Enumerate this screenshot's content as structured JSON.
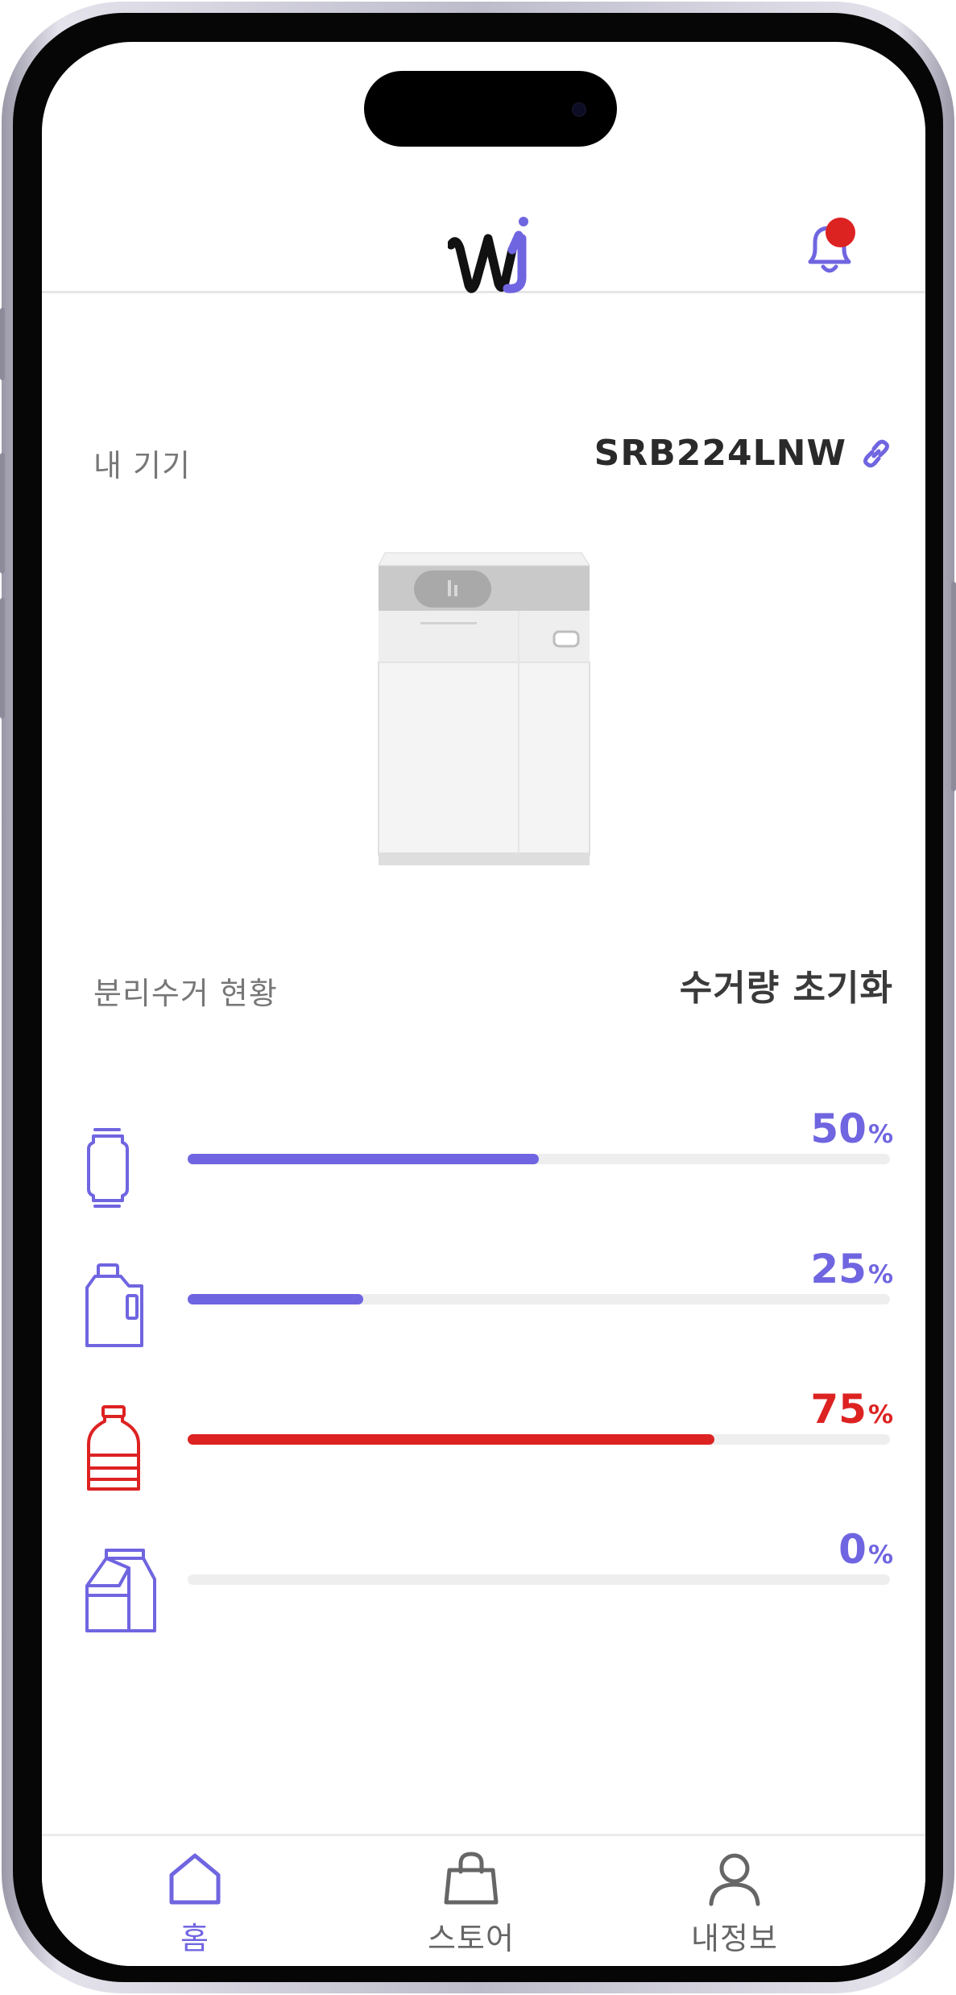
{
  "header": {
    "logo_icon": "brand-logo-icon",
    "bell_icon": "bell-icon",
    "has_notification": true
  },
  "device": {
    "label": "내 기기",
    "model": "SRB224LNW",
    "link_icon": "link-icon",
    "image": "recycling-bin-device-image"
  },
  "status": {
    "label": "분리수거 현황",
    "reset_label": "수거량 초기화",
    "bins": [
      {
        "icon": "can-icon",
        "value": 50,
        "percent_text": "50",
        "unit": "%",
        "color": "#7065e0"
      },
      {
        "icon": "jug-icon",
        "value": 25,
        "percent_text": "25",
        "unit": "%",
        "color": "#7065e0"
      },
      {
        "icon": "pet-bottle-icon",
        "value": 75,
        "percent_text": "75",
        "unit": "%",
        "color": "#dd2222"
      },
      {
        "icon": "paper-carton-icon",
        "value": 0,
        "percent_text": "0",
        "unit": "%",
        "color": "#7065e0"
      }
    ]
  },
  "nav": {
    "items": [
      {
        "label": "홈",
        "icon": "home-icon",
        "active": true
      },
      {
        "label": "스토어",
        "icon": "shopping-bag-icon",
        "active": false
      },
      {
        "label": "내정보",
        "icon": "user-icon",
        "active": false
      }
    ]
  },
  "colors": {
    "accent": "#7065e0",
    "alert": "#dd2222",
    "track": "#eeeeee",
    "inactive": "#666666"
  }
}
